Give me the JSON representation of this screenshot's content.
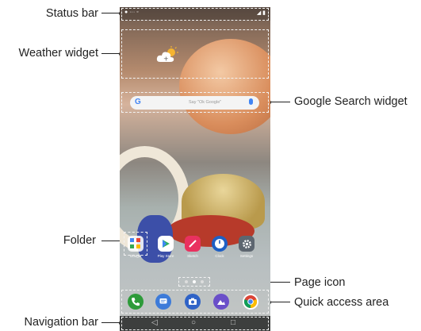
{
  "labels": {
    "status_bar": "Status bar",
    "weather_widget": "Weather widget",
    "google_search_widget": "Google Search widget",
    "folder": "Folder",
    "page_icon": "Page icon",
    "quick_access_area": "Quick access area",
    "navigation_bar": "Navigation bar"
  },
  "phone": {
    "search_hint": "Say \"Ok Google\"",
    "google_letter": "G",
    "apps": [
      "Google",
      "Play Store",
      "Sketch",
      "Clock",
      "Settings"
    ]
  },
  "colors": {
    "callout_line": "#222222",
    "dashed_box": "#f2f2f2",
    "phone_app": "#2e9b3a",
    "messages": "#3d7bd9",
    "camera": "#2f63c7",
    "gallery": "#6a4fc9",
    "play_store": "#ffffff",
    "sketch": "#e9315f",
    "clock": "#1e5fc4",
    "settings": "#5d6670"
  },
  "icons": {
    "weather": "cloud-sun-icon",
    "mic": "microphone-icon",
    "phone": "phone-icon",
    "messages": "message-icon",
    "camera": "camera-icon",
    "gallery": "gallery-icon",
    "chrome": "chrome-icon",
    "back": "back-triangle-icon",
    "home": "home-circle-icon",
    "recents": "recents-square-icon"
  }
}
